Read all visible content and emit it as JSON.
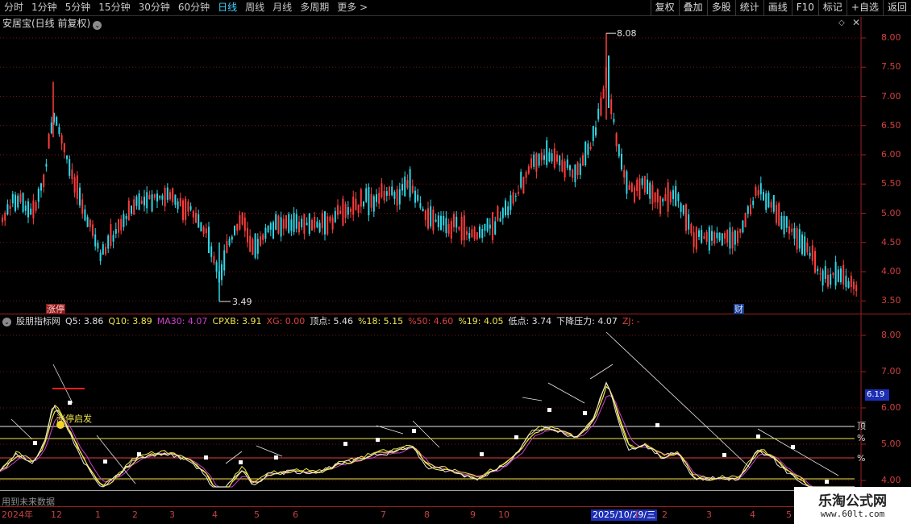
{
  "toolbar": {
    "periods": [
      "分时",
      "1分钟",
      "5分钟",
      "15分钟",
      "30分钟",
      "60分钟",
      "日线",
      "周线",
      "月线",
      "多周期",
      "更多 >"
    ],
    "active_period": "日线",
    "actions": [
      "复权",
      "叠加",
      "多股",
      "统计",
      "画线",
      "F10",
      "标记",
      "+自选",
      "返回"
    ]
  },
  "main_chart": {
    "title": "安居宝(日线 前复权)",
    "high_label": "8.08",
    "low_label": "3.49",
    "y_ticks": [
      "8.00",
      "7.50",
      "7.00",
      "6.50",
      "6.00",
      "5.50",
      "5.00",
      "4.50",
      "4.00",
      "3.50"
    ],
    "tag_limitup": "涨停",
    "tag_fin": "财"
  },
  "indicator": {
    "name": "股朋指标网",
    "values": [
      {
        "label": "Q5: 3.86",
        "color": "#e0e0e0"
      },
      {
        "label": "Q10: 3.89",
        "color": "#f2e64a"
      },
      {
        "label": "MA30: 4.07",
        "color": "#d040d0"
      },
      {
        "label": "CPXB: 3.91",
        "color": "#f2e64a"
      },
      {
        "label": "XG: 0.00",
        "color": "#e04040"
      },
      {
        "label": "顶点: 5.46",
        "color": "#e0e0e0"
      },
      {
        "label": "%18: 5.15",
        "color": "#f2e64a"
      },
      {
        "label": "%50: 4.60",
        "color": "#e04040"
      },
      {
        "label": "%19: 4.05",
        "color": "#f2e64a"
      },
      {
        "label": "低点: 3.74",
        "color": "#e0e0e0"
      },
      {
        "label": "下降压力: 4.07",
        "color": "#e0e0e0"
      },
      {
        "label": "ZJ: -",
        "color": "#e04040"
      }
    ],
    "y_ticks": [
      "8.00",
      "7.00",
      "6.00",
      "5.00",
      "4.00"
    ],
    "cursor_price": "6.19",
    "signal_label": "涨停启发",
    "side_labels": [
      "顶",
      "%",
      "%"
    ],
    "future_note": "用到未来数据"
  },
  "date_axis": {
    "labels": [
      "2024年",
      "12",
      "1",
      "2",
      "3",
      "4",
      "5",
      "6",
      "7",
      "8",
      "9",
      "10",
      "2025/10/29/三",
      "1",
      "2",
      "3",
      "4",
      "5",
      "6"
    ],
    "cursor_date": "2025/10/29/三"
  },
  "watermark": {
    "title": "乐淘公式网",
    "url": "www.60lt.com"
  },
  "colors": {
    "up": "#ff3c3c",
    "down": "#2fd6e6",
    "grid": "#7a1515",
    "white_line": "#e8e8e8",
    "yellow_line": "#f2e64a",
    "magenta_line": "#d040d0"
  }
}
